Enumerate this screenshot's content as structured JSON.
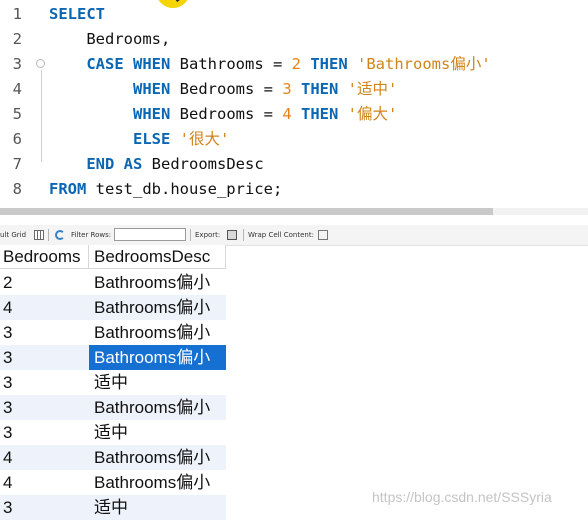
{
  "editor": {
    "lines": [
      {
        "n": "1",
        "indent": "",
        "tokens": [
          {
            "t": "SELECT",
            "c": "kw"
          }
        ]
      },
      {
        "n": "2",
        "indent": "    ",
        "tokens": [
          {
            "t": "Bedrooms,",
            "c": "plain"
          }
        ]
      },
      {
        "n": "3",
        "indent": "    ",
        "tokens": [
          {
            "t": "CASE",
            "c": "kw"
          },
          {
            "t": " ",
            "c": "plain"
          },
          {
            "t": "WHEN",
            "c": "kw"
          },
          {
            "t": " Bathrooms = ",
            "c": "plain"
          },
          {
            "t": "2",
            "c": "num"
          },
          {
            "t": " ",
            "c": "plain"
          },
          {
            "t": "THEN",
            "c": "kw"
          },
          {
            "t": " ",
            "c": "plain"
          },
          {
            "t": "'Bathrooms偏小'",
            "c": "str"
          }
        ]
      },
      {
        "n": "4",
        "indent": "         ",
        "tokens": [
          {
            "t": "WHEN",
            "c": "kw"
          },
          {
            "t": " Bedrooms = ",
            "c": "plain"
          },
          {
            "t": "3",
            "c": "num"
          },
          {
            "t": " ",
            "c": "plain"
          },
          {
            "t": "THEN",
            "c": "kw"
          },
          {
            "t": " ",
            "c": "plain"
          },
          {
            "t": "'适中'",
            "c": "str"
          }
        ]
      },
      {
        "n": "5",
        "indent": "         ",
        "tokens": [
          {
            "t": "WHEN",
            "c": "kw"
          },
          {
            "t": " Bedrooms = ",
            "c": "plain"
          },
          {
            "t": "4",
            "c": "num"
          },
          {
            "t": " ",
            "c": "plain"
          },
          {
            "t": "THEN",
            "c": "kw"
          },
          {
            "t": " ",
            "c": "plain"
          },
          {
            "t": "'偏大'",
            "c": "str"
          }
        ]
      },
      {
        "n": "6",
        "indent": "         ",
        "tokens": [
          {
            "t": "ELSE",
            "c": "kw"
          },
          {
            "t": " ",
            "c": "plain"
          },
          {
            "t": "'很大'",
            "c": "str"
          }
        ]
      },
      {
        "n": "7",
        "indent": "    ",
        "tokens": [
          {
            "t": "END",
            "c": "kw"
          },
          {
            "t": " ",
            "c": "plain"
          },
          {
            "t": "AS",
            "c": "kw"
          },
          {
            "t": " BedroomsDesc",
            "c": "plain"
          }
        ]
      },
      {
        "n": "8",
        "indent": "",
        "tokens": [
          {
            "t": "FROM",
            "c": "kw"
          },
          {
            "t": " test_db.house_price;",
            "c": "plain"
          }
        ]
      }
    ]
  },
  "toolbar": {
    "result_grid_label": "ult Grid",
    "filter_label": "Filter Rows:",
    "filter_value": "",
    "export_label": "Export:",
    "wrap_label": "Wrap Cell Content:"
  },
  "grid": {
    "columns": [
      "Bedrooms",
      "BedroomsDesc"
    ],
    "rows": [
      [
        "2",
        "Bathrooms偏小"
      ],
      [
        "4",
        "Bathrooms偏小"
      ],
      [
        "3",
        "Bathrooms偏小"
      ],
      [
        "3",
        "Bathrooms偏小"
      ],
      [
        "3",
        "适中"
      ],
      [
        "3",
        "Bathrooms偏小"
      ],
      [
        "3",
        "适中"
      ],
      [
        "4",
        "Bathrooms偏小"
      ],
      [
        "4",
        "Bathrooms偏小"
      ],
      [
        "3",
        "适中"
      ]
    ],
    "selected_row": 3
  },
  "watermark": "https://blog.csdn.net/SSSyria",
  "colors": {
    "keyword": "#0b67b4",
    "string": "#d0841a",
    "number": "#e8811a",
    "selection": "#1670d2",
    "alt_row": "#eef2fb"
  }
}
